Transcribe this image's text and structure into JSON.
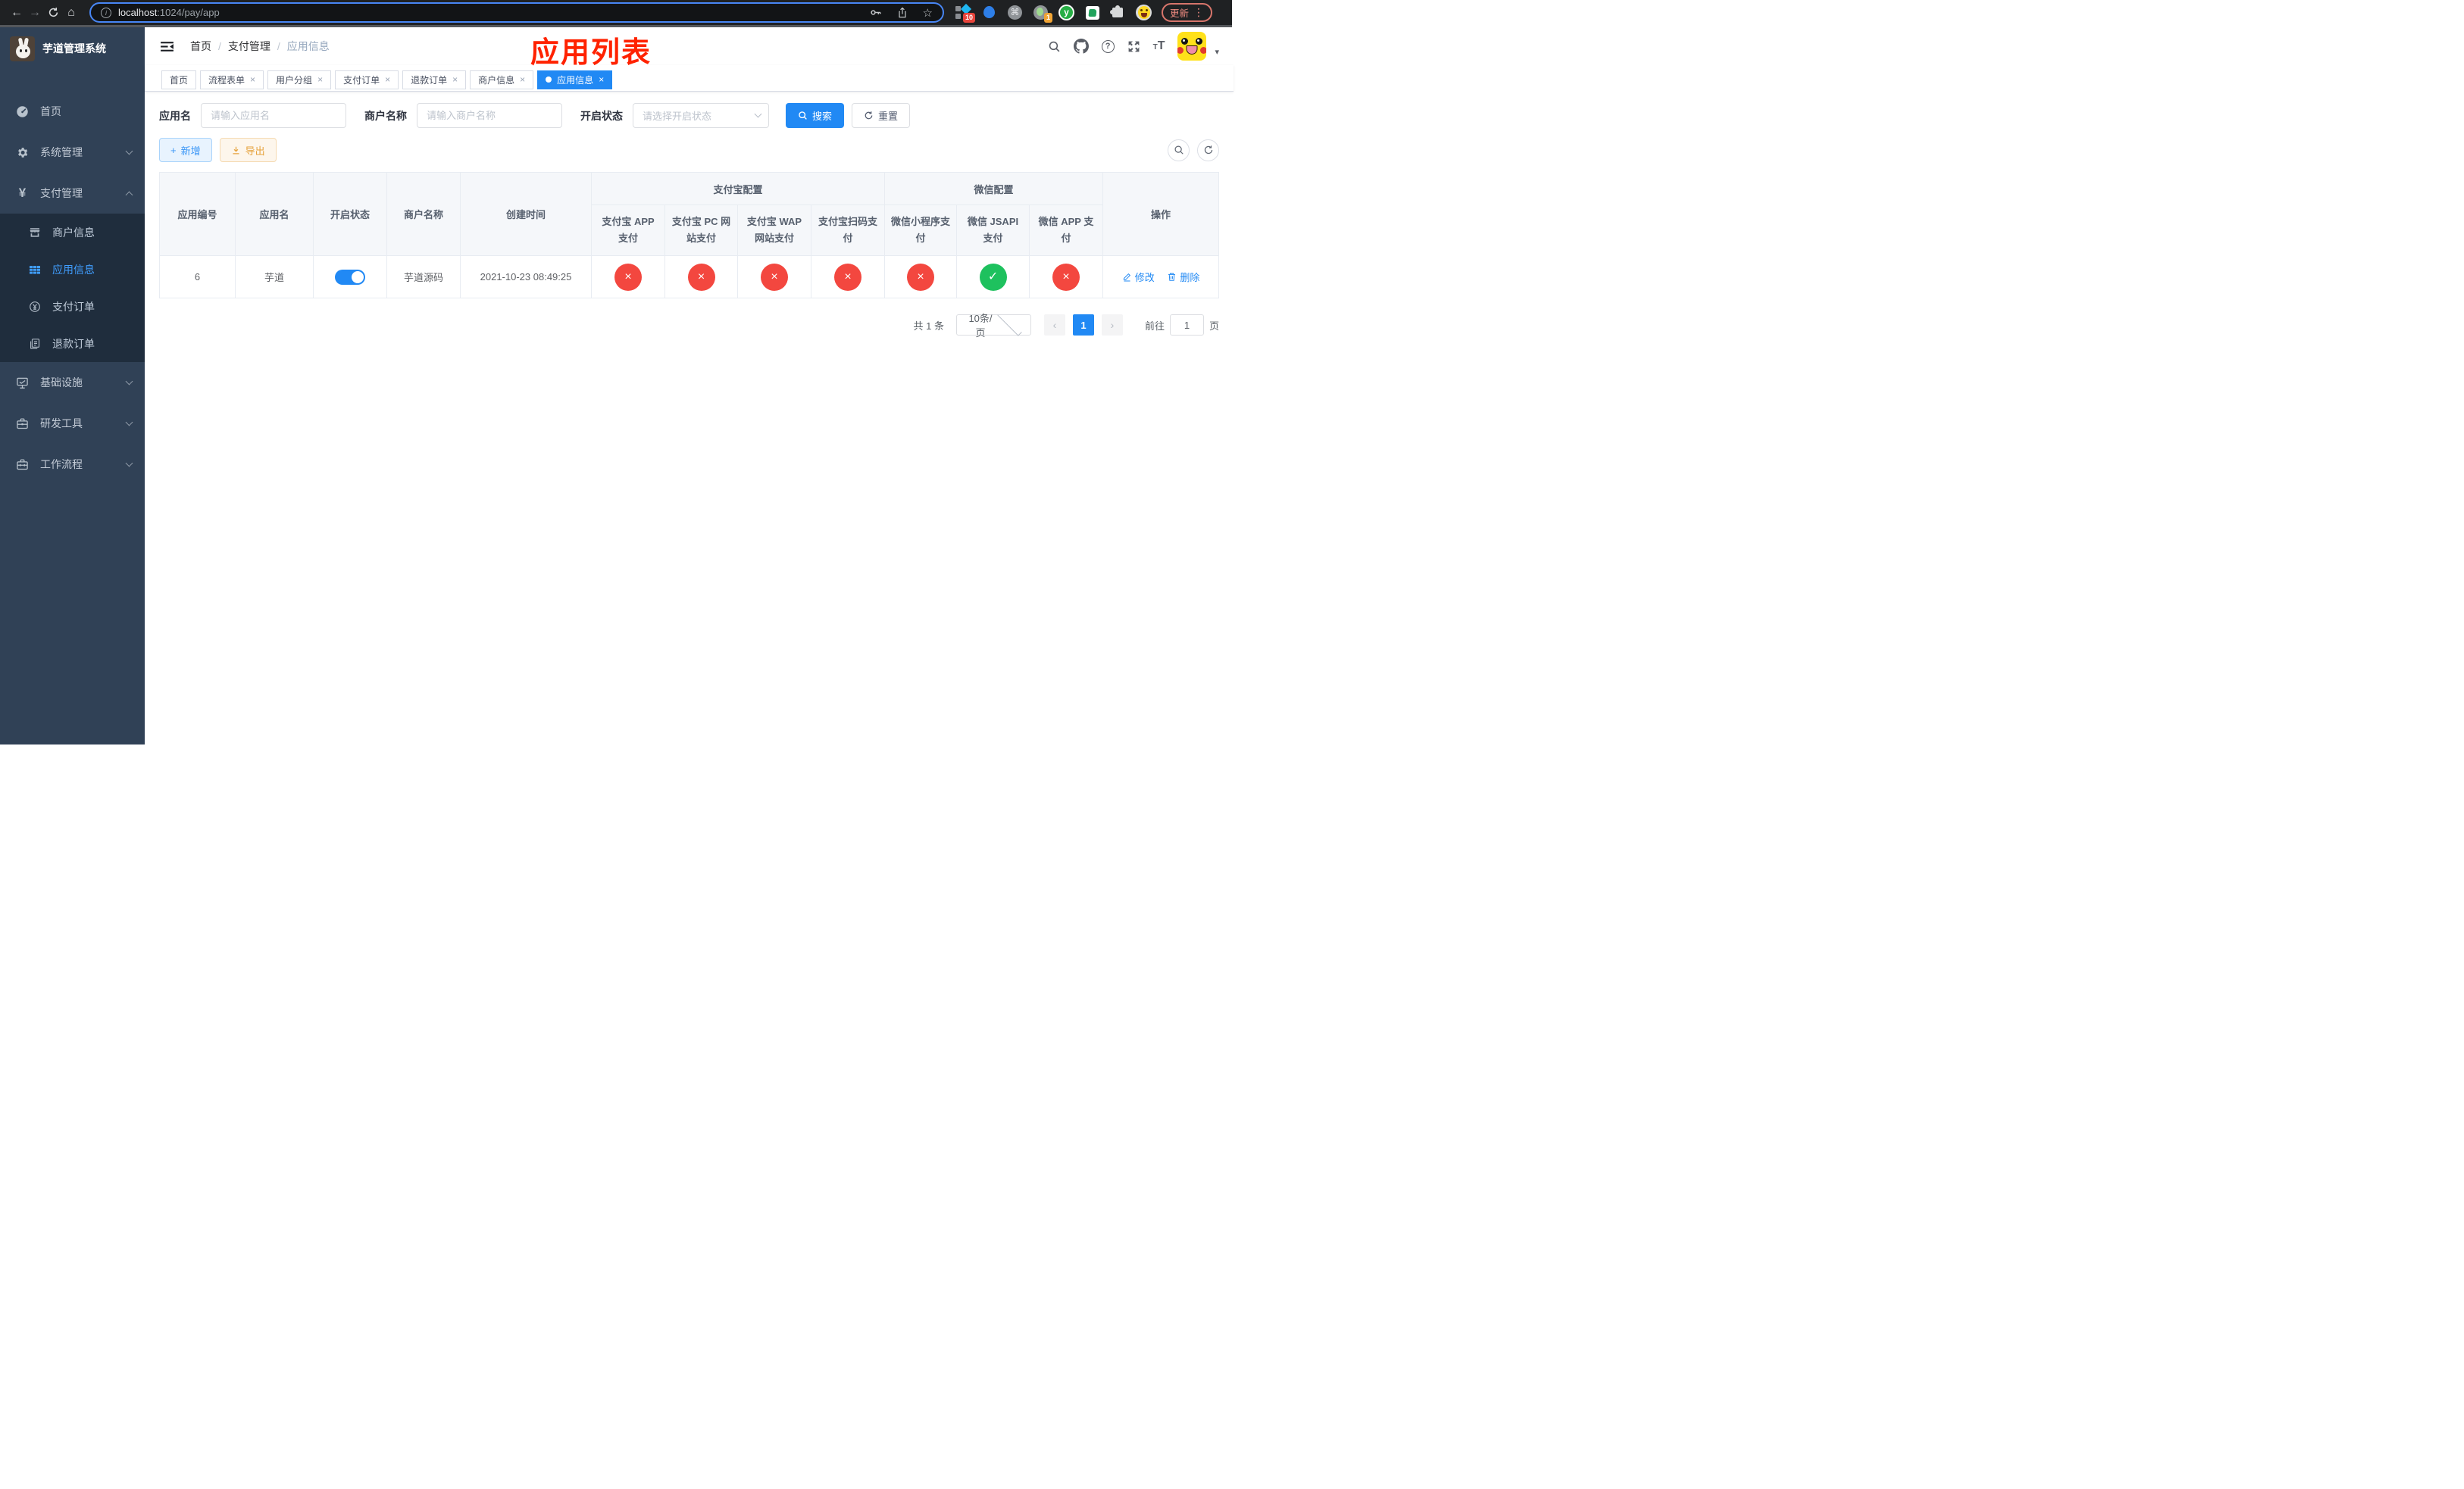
{
  "colors": {
    "primary": "#2189f4",
    "danger": "#f3473f",
    "success": "#1ec15e",
    "warning": "#e6a23c",
    "annotation_red": "#ff2200",
    "sidebar_bg": "#304156",
    "sidebar_submenu_bg": "#1f2d3d",
    "active_menu_text": "#409eff"
  },
  "browser": {
    "url_host": "localhost",
    "url_rest": ":1024/pay/app",
    "extension_badge_a": "10",
    "extension_badge_b": "1",
    "update_button": "更新"
  },
  "icons": {
    "back": "←",
    "forward": "→",
    "home": "⌂",
    "star": "☆",
    "command": "⌘",
    "kebab": "⋮",
    "caret_down": "▾",
    "info": "i",
    "question": "?",
    "plus": "+",
    "close": "×",
    "check": "✓",
    "prev": "‹",
    "next": "›",
    "yuan": "¥",
    "font_small": "T",
    "font_big": "T",
    "tab_close": "×"
  },
  "sidebar": {
    "title": "芋道管理系统",
    "items": [
      {
        "label": "首页"
      },
      {
        "label": "系统管理"
      },
      {
        "label": "支付管理"
      },
      {
        "label": "基础设施"
      },
      {
        "label": "研发工具"
      },
      {
        "label": "工作流程"
      }
    ],
    "submenu": [
      {
        "label": "商户信息"
      },
      {
        "label": "应用信息"
      },
      {
        "label": "支付订单"
      },
      {
        "label": "退款订单"
      }
    ]
  },
  "header": {
    "breadcrumb": [
      "首页",
      "支付管理",
      "应用信息"
    ],
    "separator": "/"
  },
  "annotation": {
    "title": "应用列表"
  },
  "tabs": [
    {
      "label": "首页"
    },
    {
      "label": "流程表单"
    },
    {
      "label": "用户分组"
    },
    {
      "label": "支付订单"
    },
    {
      "label": "退款订单"
    },
    {
      "label": "商户信息"
    },
    {
      "label": "应用信息"
    }
  ],
  "filters": {
    "app_name_label": "应用名",
    "app_name_placeholder": "请输入应用名",
    "merchant_label": "商户名称",
    "merchant_placeholder": "请输入商户名称",
    "status_label": "开启状态",
    "status_placeholder": "请选择开启状态",
    "search_button": "搜索",
    "reset_button": "重置"
  },
  "toolbar": {
    "add_button": "新增",
    "export_button": "导出"
  },
  "table": {
    "groups": {
      "alipay": "支付宝配置",
      "wechat": "微信配置"
    },
    "columns": [
      "应用编号",
      "应用名",
      "开启状态",
      "商户名称",
      "创建时间",
      "支付宝 APP 支付",
      "支付宝 PC 网站支付",
      "支付宝 WAP 网站支付",
      "支付宝扫码支付",
      "微信小程序支付",
      "微信 JSAPI 支付",
      "微信 APP 支付",
      "操作"
    ],
    "row": {
      "id": "6",
      "name": "芋道",
      "enabled": true,
      "merchant": "芋道源码",
      "created_at": "2021-10-23 08:49:25",
      "config_status": [
        false,
        false,
        false,
        false,
        false,
        true,
        false
      ],
      "edit_action": "修改",
      "delete_action": "删除"
    }
  },
  "pagination": {
    "total": "共 1 条",
    "page_size": "10条/页",
    "current_page": "1",
    "goto_label": "前往",
    "goto_value": "1",
    "page_unit": "页"
  }
}
